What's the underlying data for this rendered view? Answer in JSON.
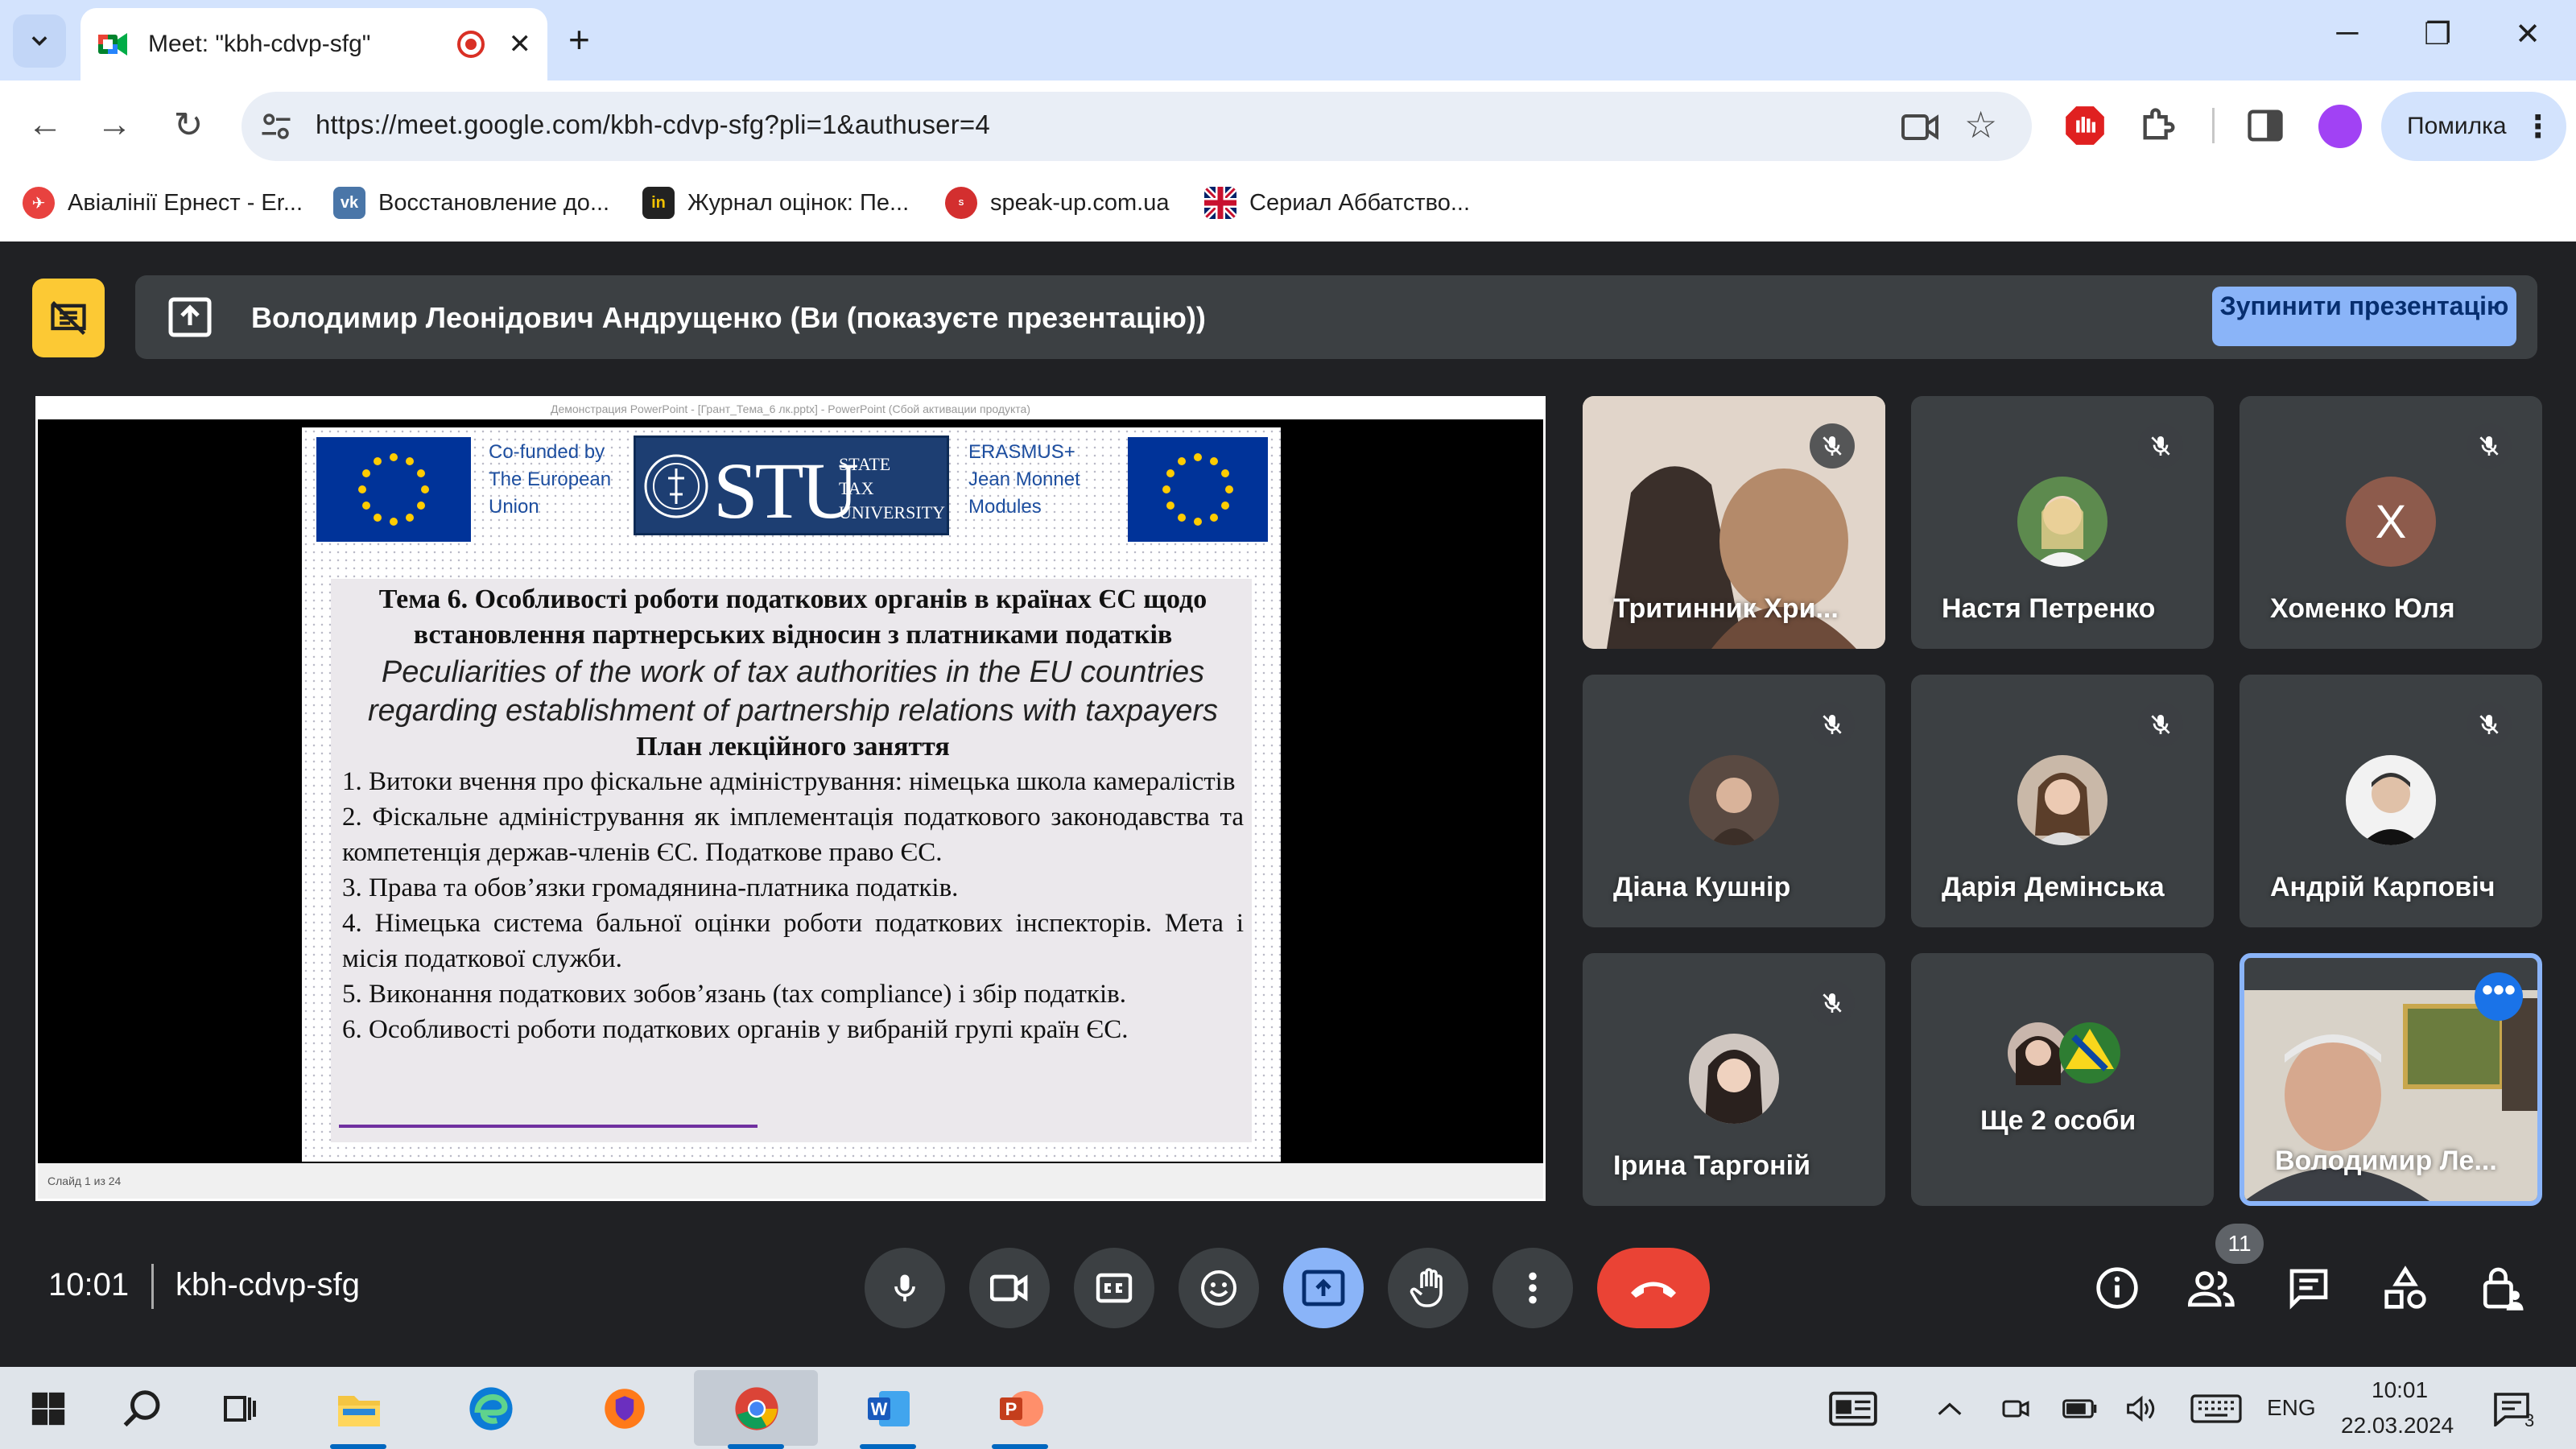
{
  "browser": {
    "tab_title": "Meet: \"kbh-cdvp-sfg\"",
    "url": "https://meet.google.com/kbh-cdvp-sfg?pli=1&authuser=4",
    "profile_label": "Помилка",
    "bookmarks": [
      {
        "label": "Авіалінії Ернест - Er..."
      },
      {
        "label": "Восстановление до..."
      },
      {
        "label": "Журнал оцінок: Пе..."
      },
      {
        "label": "speak-up.com.ua"
      },
      {
        "label": "Сериал Аббатство..."
      }
    ]
  },
  "meet": {
    "presenter_banner": "Володимир Леонідович Андрущенко (Ви (показуєте презентацію))",
    "stop_button": "Зупинити презентацію",
    "clock": "10:01",
    "meeting_code": "kbh-cdvp-sfg",
    "participants_count": "11",
    "participants": [
      {
        "name": "Тритинник Хри..."
      },
      {
        "name": "Настя Петренко"
      },
      {
        "name": "Хоменко Юля",
        "initial": "Х"
      },
      {
        "name": "Діана Кушнір"
      },
      {
        "name": "Дарія Демінська"
      },
      {
        "name": "Андрій Карповіч"
      },
      {
        "name": "Ірина Таргоній"
      },
      {
        "name": "Ще 2 особи"
      },
      {
        "name": "Володимир Ле..."
      }
    ]
  },
  "powerpoint": {
    "window_title": "Демонстрация PowerPoint - [Грант_Тема_6 лк.pptx] - PowerPoint (Сбой активации продукта)",
    "status": "Слайд 1 из 24"
  },
  "slide": {
    "cofunded": [
      "Co-funded by",
      "The European",
      "Union"
    ],
    "stu_big": "STU",
    "stu_small": [
      "STATE",
      "TAX",
      "UNIVERSITY"
    ],
    "erasmus": [
      "ERASMUS+",
      "Jean Monnet",
      "Modules"
    ],
    "title": "Тема 6. Особливості роботи податкових органів в країнах ЄС щодо встановлення партнерських відносин з платниками податків",
    "title_en": "Peculiarities of the work of tax authorities in the EU countries regarding establishment of partnership relations with taxpayers",
    "plan": "План лекційного заняття",
    "items": [
      "1. Витоки вчення про фіскальне адміністрування: німецька школа камералістів",
      "2. Фіскальне адміністрування як імплементація податкового законодавства та компетенція держав-членів ЄС. Податкове право ЄС.",
      "3. Права та обов’язки громадянина-платника податків.",
      "4. Німецька система бальної оцінки роботи податкових інспекторів. Мета і місія податкової служби.",
      "5. Виконання податкових зобов’язань (tax compliance) і збір податків.",
      "6. Особливості роботи податкових органів у вибраній групі країн ЄС."
    ]
  },
  "taskbar": {
    "language": "ENG",
    "time": "10:01",
    "date": "22.03.2024",
    "notifications": "3"
  },
  "colors": {
    "meet_bg": "#202124",
    "tile_bg": "#3c4043",
    "accent_blue": "#8ab4f8",
    "hangup_red": "#ea4335",
    "banner_yellow": "#fcc934",
    "tab_bar": "#d3e3fd"
  }
}
